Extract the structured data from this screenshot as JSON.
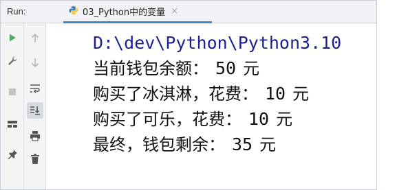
{
  "panel": {
    "title": "Run:"
  },
  "tab": {
    "name": "03_Python中的变量",
    "close": "×",
    "accent": "#4083c9"
  },
  "toolbar_left": [
    {
      "icon": "run-icon",
      "color": "#59a869"
    },
    {
      "icon": "wrench-icon",
      "color": "#6e6e6e"
    },
    {
      "icon": "stop-icon",
      "color": "#c4c4c4"
    },
    {
      "icon": "layout-icon",
      "color": "#555555"
    },
    {
      "icon": "pin-icon",
      "color": "#555555"
    }
  ],
  "toolbar_right": [
    {
      "icon": "arrow-up-icon"
    },
    {
      "icon": "arrow-down-icon"
    },
    {
      "icon": "soft-wrap-icon"
    },
    {
      "icon": "scroll-to-end-icon",
      "selected": true
    },
    {
      "icon": "print-icon"
    },
    {
      "icon": "trash-icon"
    }
  ],
  "console": {
    "path": "D:\\dev\\Python\\Python3.10",
    "lines": [
      {
        "label": "当前钱包余额：",
        "value": "50",
        "unit": "元"
      },
      {
        "label": "购买了冰淇淋，花费：",
        "value": "10",
        "unit": "元"
      },
      {
        "label": "购买了可乐，花费：",
        "value": "10",
        "unit": "元"
      },
      {
        "label": "最终，钱包剩余：",
        "value": "35",
        "unit": "元"
      }
    ]
  }
}
